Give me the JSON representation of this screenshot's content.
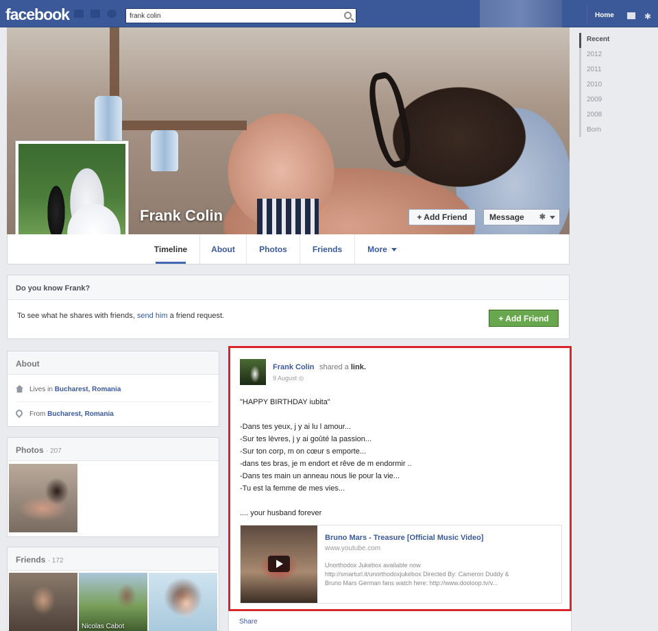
{
  "topbar": {
    "logo": "facebook",
    "search_value": "frank colin",
    "home_label": "Home",
    "icons": [
      "friend-requests-icon",
      "messages-icon",
      "notifications-icon",
      "search-icon",
      "friends-icon",
      "gear-icon"
    ]
  },
  "profile": {
    "name": "Frank Colin",
    "add_friend_label": "Add Friend",
    "message_label": "Message"
  },
  "tabs": [
    {
      "label": "Timeline"
    },
    {
      "label": "About"
    },
    {
      "label": "Photos"
    },
    {
      "label": "Friends"
    },
    {
      "label": "More"
    }
  ],
  "timeline_years": [
    "Recent",
    "2012",
    "2011",
    "2010",
    "2009",
    "2008",
    "Born"
  ],
  "know_box": {
    "title": "Do you know Frank?",
    "text_before": "To see what he shares with friends, ",
    "link_text": "send him",
    "text_after": " a friend request.",
    "button_label": "Add Friend"
  },
  "about_card": {
    "title": "About",
    "lives_prefix": "Lives in ",
    "lives_value": "Bucharest, Romania",
    "from_prefix": "From ",
    "from_value": "Bucharest, Romania"
  },
  "photos_card": {
    "title": "Photos",
    "count": "· 207"
  },
  "friends_card": {
    "title": "Friends",
    "count": "· 172",
    "friend_2_label": "Nicolas Cabot",
    "friend_1_label": ""
  },
  "post": {
    "author": "Frank Colin",
    "action_prefix": "shared a ",
    "action_object": "link.",
    "date": "9 August",
    "lines": [
      "\"HAPPY BIRTHDAY iubita\"",
      "",
      "-Dans tes yeux, j y ai lu l amour...",
      "-Sur tes lèvres, j y ai goûté la passion...",
      "-Sur ton corp, m on cœur s emporte...",
      "-dans tes bras, je m endort et rêve de m endormir ..",
      "-Dans tes main un anneau nous lie pour la vie...",
      "-Tu est la femme de mes vies...",
      "",
      ".... your husband forever"
    ],
    "link_title": "Bruno Mars - Treasure [Official Music Video]",
    "link_domain": "www.youtube.com",
    "link_desc_1": "Unorthodox Jukebox available now",
    "link_desc_2": "http://smarturl.it/unorthodoxjukebox Directed By: Cameron Duddy &",
    "link_desc_3": "Bruno Mars German fans watch here: http://www.dooloop.tv/v...",
    "share_label": "Share"
  }
}
